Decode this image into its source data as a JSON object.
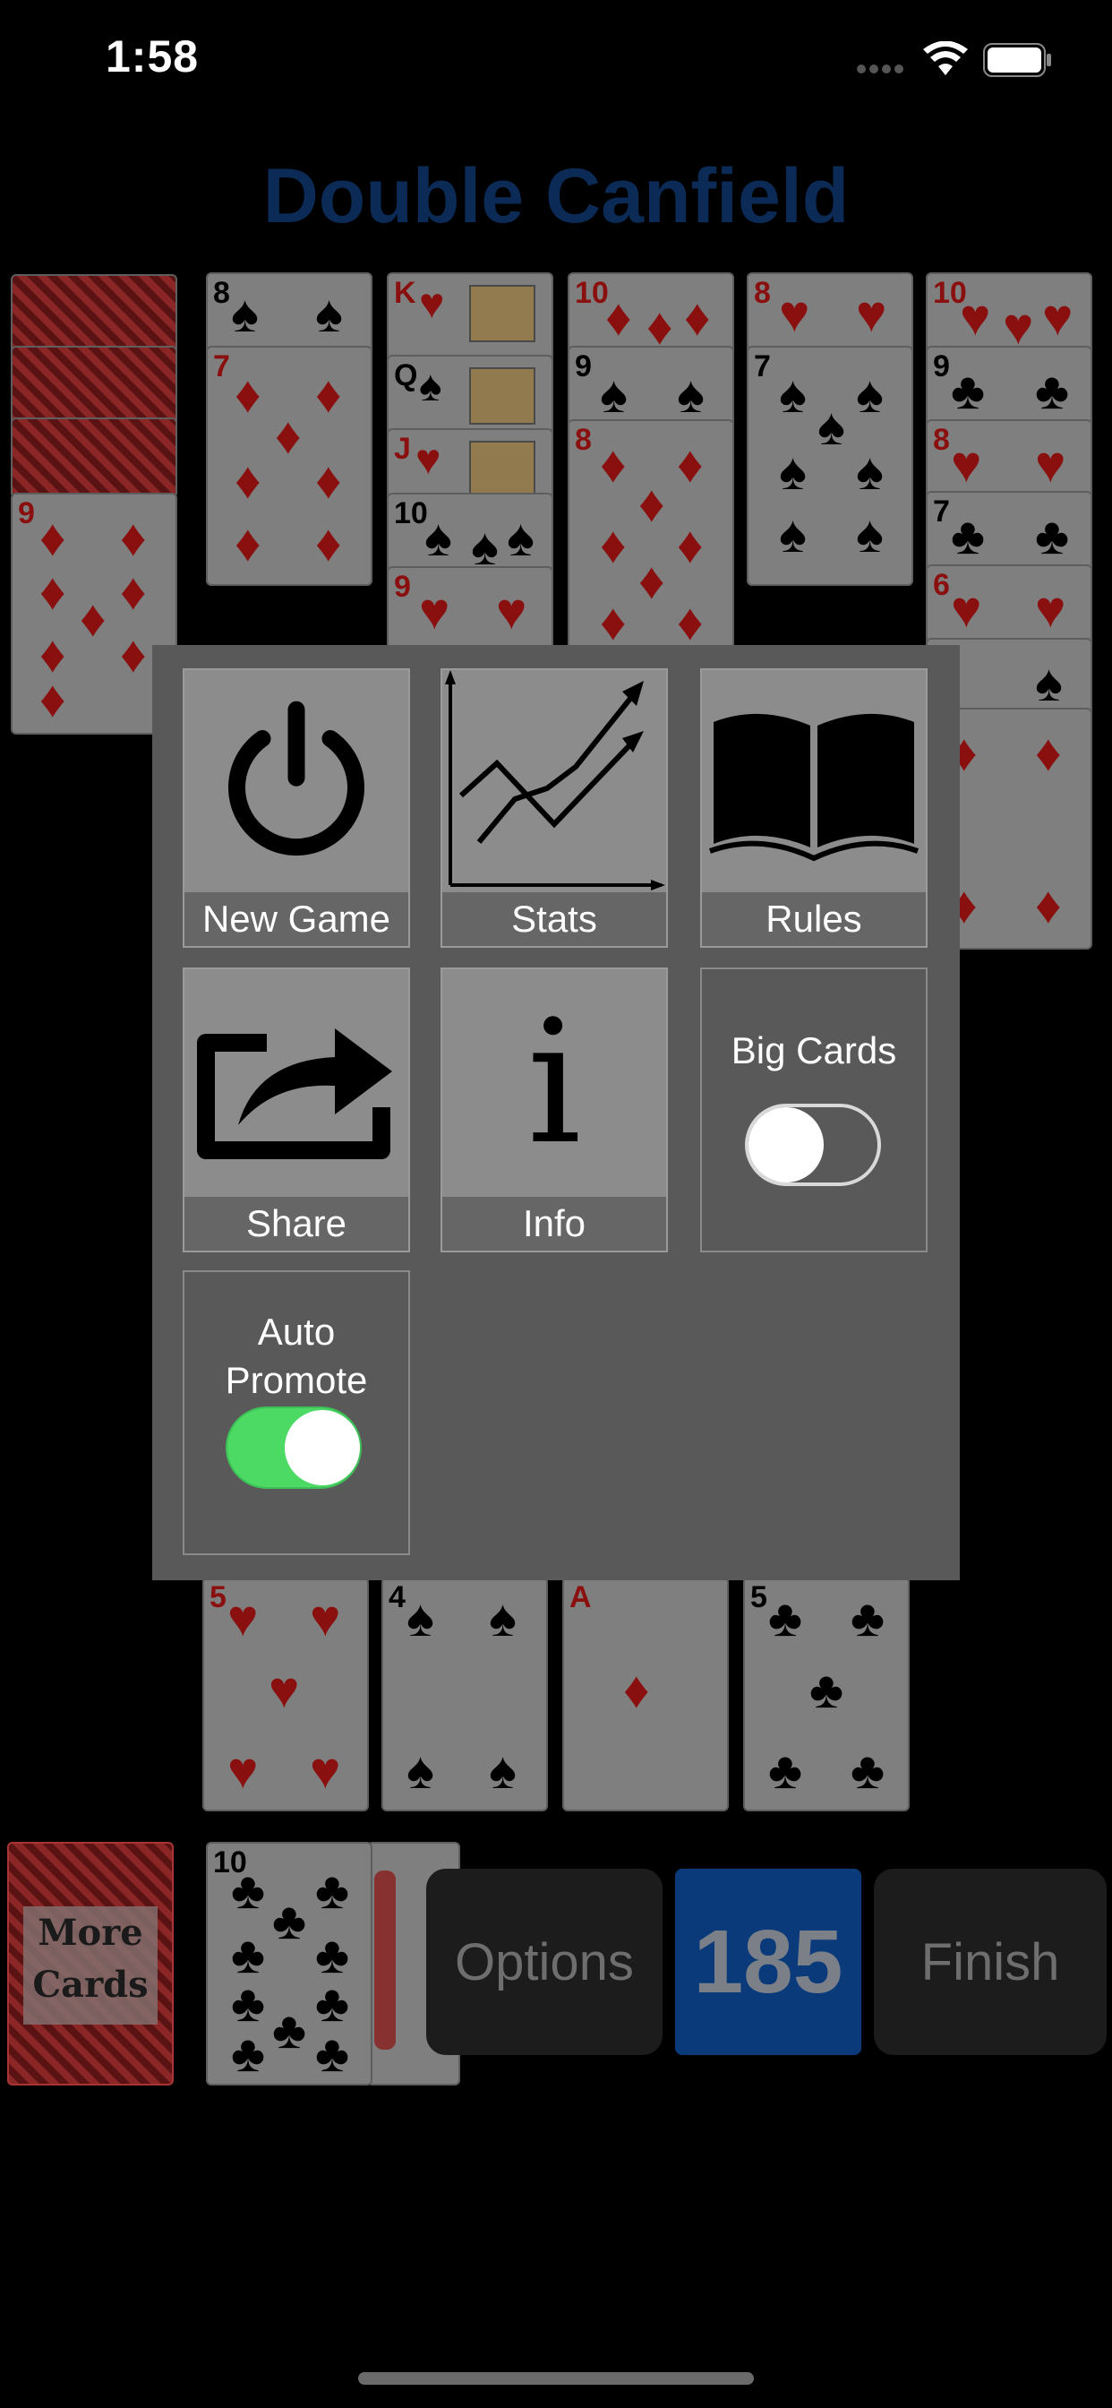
{
  "status_bar": {
    "time": "1:58"
  },
  "title": "Double Canfield",
  "tableau": [
    {
      "cards": [
        "9♦"
      ]
    },
    {
      "cards": [
        "8♠",
        "7♦"
      ]
    },
    {
      "cards": [
        "K♥",
        "Q♠",
        "J♥",
        "10♠",
        "9♥"
      ]
    },
    {
      "cards": [
        "10♦",
        "9♠",
        "8♦"
      ]
    },
    {
      "cards": [
        "8♥",
        "7♠"
      ]
    },
    {
      "cards": [
        "10♥",
        "9♣",
        "8♥",
        "7♣",
        "6♥",
        "5♠",
        "4♦"
      ]
    }
  ],
  "foundations": [
    {
      "rank": "5",
      "suit": "♥"
    },
    {
      "rank": "4",
      "suit": "♠"
    },
    {
      "rank": "A",
      "suit": "♦"
    },
    {
      "rank": "5",
      "suit": "♣"
    }
  ],
  "stock": {
    "label_line1": "More",
    "label_line2": "Cards"
  },
  "waste": {
    "top_card_rank": "10",
    "top_card_suit": "♣"
  },
  "menu": {
    "new_game": "New Game",
    "stats": "Stats",
    "rules": "Rules",
    "share": "Share",
    "info": "Info",
    "info_glyph": "i",
    "big_cards": {
      "label": "Big Cards",
      "on": false
    },
    "auto_promote": {
      "label_line1": "Auto",
      "label_line2": "Promote",
      "on": true
    }
  },
  "bottom_bar": {
    "options_label": "Options",
    "score": "185",
    "finish_label": "Finish"
  },
  "colors": {
    "toggle_on": "#4cd964",
    "score_bg": "#0a3a7a",
    "title": "#0b2a55"
  }
}
